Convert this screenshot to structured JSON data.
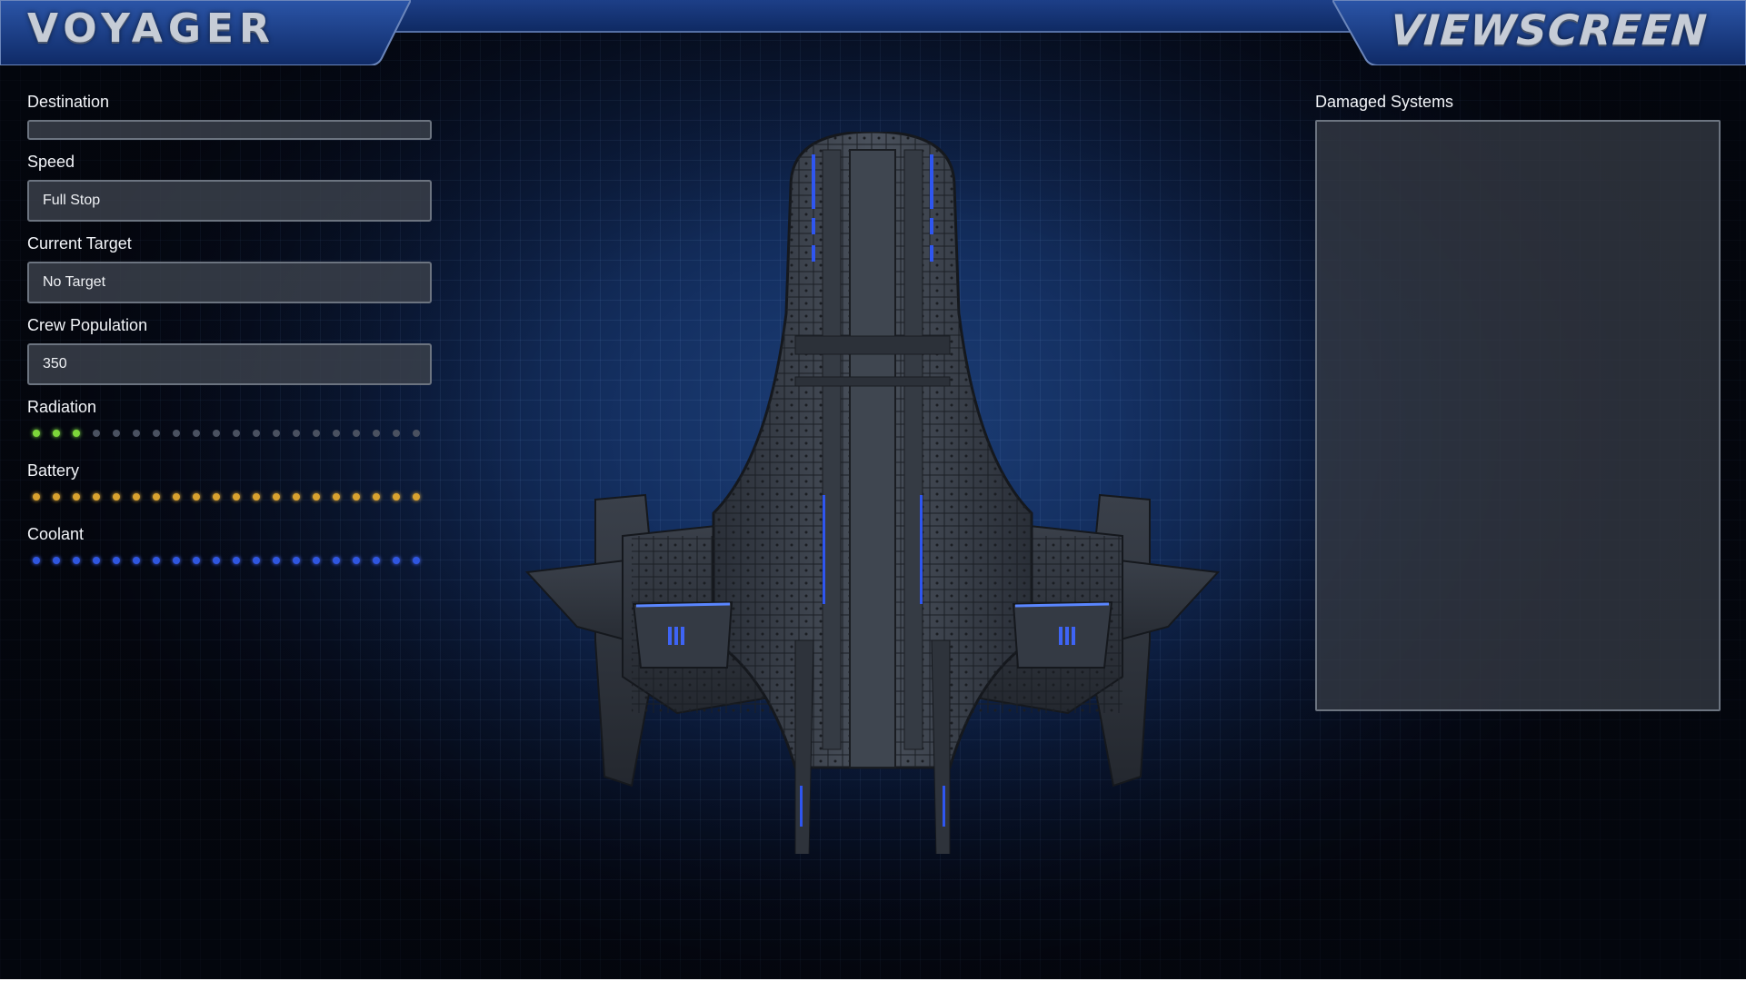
{
  "header": {
    "left_title": "VOYAGER",
    "right_title": "VIEWSCREEN"
  },
  "fields": {
    "destination": {
      "label": "Destination",
      "value": ""
    },
    "speed": {
      "label": "Speed",
      "value": "Full Stop"
    },
    "current_target": {
      "label": "Current Target",
      "value": "No Target"
    },
    "crew_population": {
      "label": "Crew Population",
      "value": "350"
    }
  },
  "meters": {
    "radiation": {
      "label": "Radiation",
      "lit": 3,
      "total": 20,
      "color": "#7dd63a"
    },
    "battery": {
      "label": "Battery",
      "lit": 20,
      "total": 20,
      "color": "#d9a22f"
    },
    "coolant": {
      "label": "Coolant",
      "lit": 20,
      "total": 20,
      "color": "#2f56e0"
    }
  },
  "damaged_systems": {
    "label": "Damaged Systems",
    "items": []
  },
  "colors": {
    "panel_accent": "#1d3f88",
    "background": "#143062"
  }
}
